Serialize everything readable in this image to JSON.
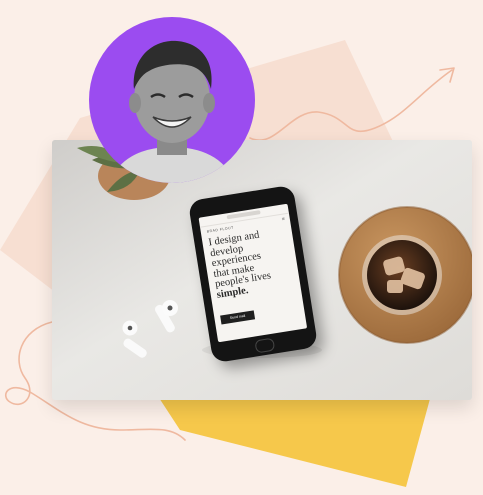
{
  "colors": {
    "background": "#fbefe8",
    "accent_purple": "#9b4cf0",
    "accent_yellow": "#f6c84b",
    "peach_shape": "#f7dfd2",
    "line_color": "#efb9a0"
  },
  "icons": [
    "arrow-icon"
  ],
  "phone": {
    "brand": "BRAD FLOUT",
    "menu": "≡",
    "headline_lines": [
      "I design and",
      "develop",
      "experiences",
      "that make",
      "people's lives",
      "simple."
    ],
    "cta": "Send mail"
  }
}
